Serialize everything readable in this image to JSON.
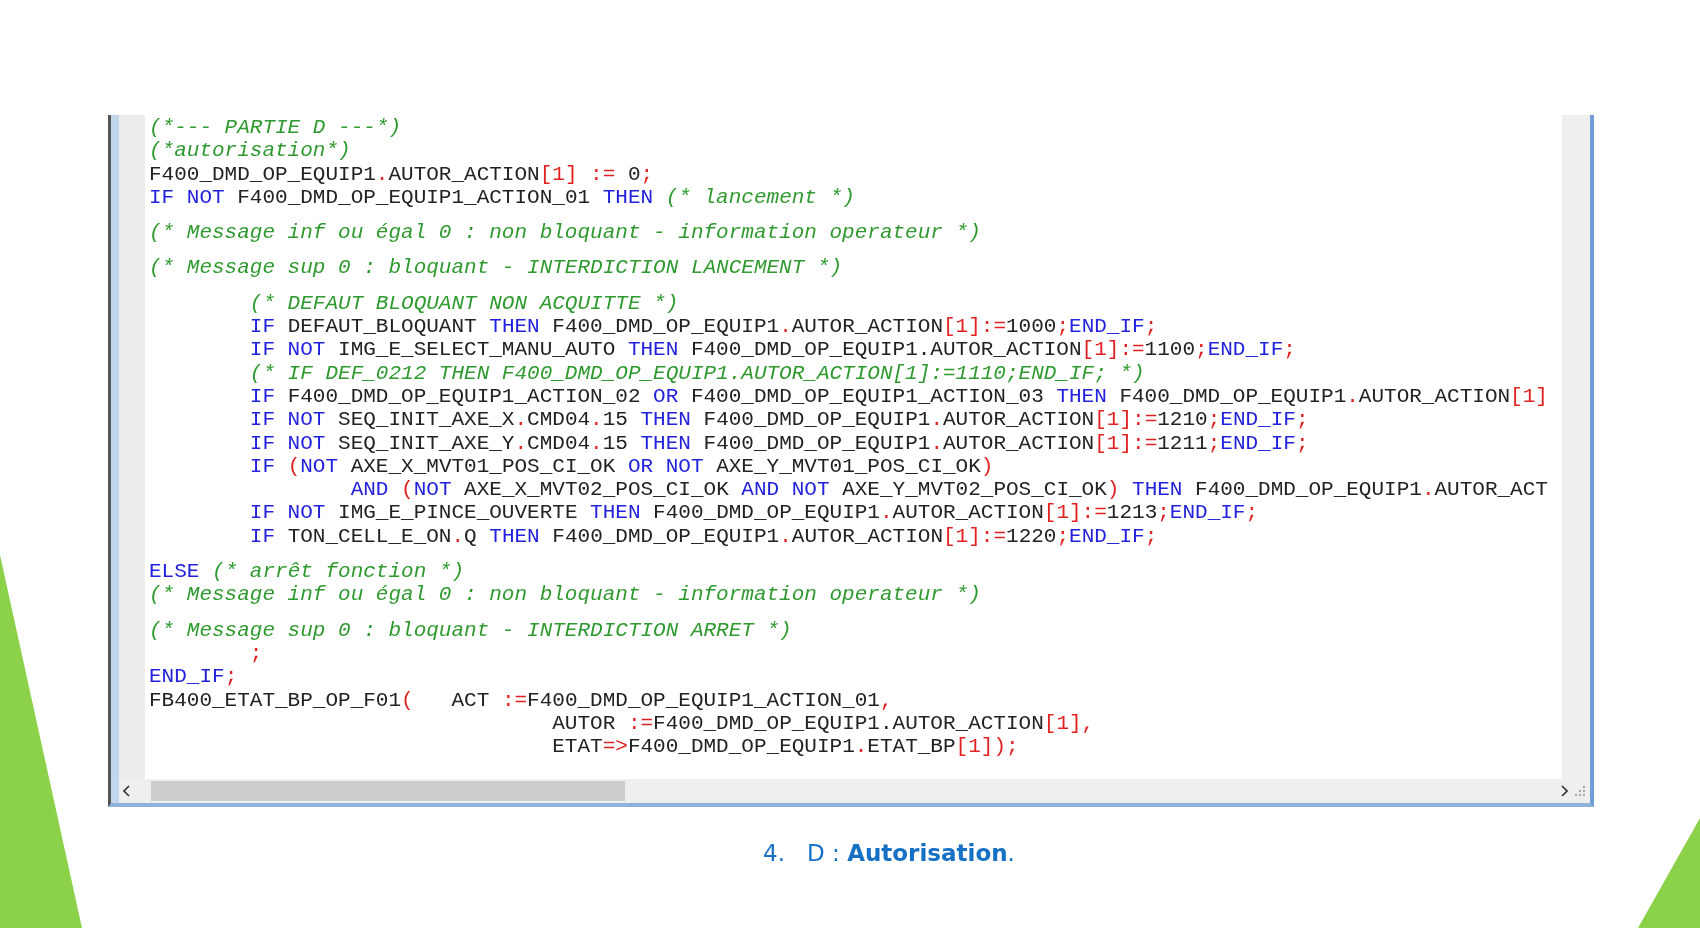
{
  "editor": {
    "blocks": [
      {
        "lines": [
          {
            "tokens": [
              {
                "kind": "cmt",
                "text": "(*--- PARTIE D ---*)"
              }
            ]
          },
          {
            "tokens": [
              {
                "kind": "cmt",
                "text": "(*autorisation*)"
              }
            ]
          },
          {
            "tokens": [
              {
                "kind": "id",
                "text": "F400_DMD_OP_EQUIP1"
              },
              {
                "kind": "op",
                "text": "."
              },
              {
                "kind": "id",
                "text": "AUTOR_ACTION"
              },
              {
                "kind": "op",
                "text": "[1]"
              },
              {
                "kind": "op",
                "text": " :="
              },
              {
                "kind": "id",
                "text": " 0"
              },
              {
                "kind": "op",
                "text": ";"
              }
            ]
          },
          {
            "tokens": [
              {
                "kind": "kw",
                "text": "IF NOT"
              },
              {
                "kind": "id",
                "text": " F400_DMD_OP_EQUIP1_ACTION_01 "
              },
              {
                "kind": "kw",
                "text": "THEN"
              },
              {
                "kind": "cmt",
                "text": " (* lancement *)"
              }
            ]
          }
        ]
      },
      {
        "lines": [
          {
            "tokens": [
              {
                "kind": "cmt",
                "text": "(* Message inf ou égal 0 : non bloquant - information operateur *)"
              }
            ]
          }
        ]
      },
      {
        "lines": [
          {
            "tokens": [
              {
                "kind": "cmt",
                "text": "(* Message sup 0 : bloquant - INTERDICTION LANCEMENT *)"
              }
            ]
          }
        ]
      },
      {
        "lines": [
          {
            "tokens": [
              {
                "kind": "cmt",
                "text": "        (* DEFAUT BLOQUANT NON ACQUITTE *)"
              }
            ]
          },
          {
            "tokens": [
              {
                "kind": "kw",
                "text": "        IF"
              },
              {
                "kind": "id",
                "text": " DEFAUT_BLOQUANT "
              },
              {
                "kind": "kw",
                "text": "THEN"
              },
              {
                "kind": "id",
                "text": " F400_DMD_OP_EQUIP1"
              },
              {
                "kind": "op",
                "text": "."
              },
              {
                "kind": "id",
                "text": "AUTOR_ACTION"
              },
              {
                "kind": "op",
                "text": "[1]:="
              },
              {
                "kind": "id",
                "text": "1000"
              },
              {
                "kind": "op",
                "text": ";"
              },
              {
                "kind": "kw",
                "text": "END_IF"
              },
              {
                "kind": "op",
                "text": ";"
              }
            ]
          },
          {
            "tokens": [
              {
                "kind": "kw",
                "text": "        IF NOT"
              },
              {
                "kind": "id",
                "text": " IMG_E_SELECT_MANU_AUTO "
              },
              {
                "kind": "kw",
                "text": "THEN"
              },
              {
                "kind": "id",
                "text": " F400_DMD_OP_EQUIP1.AUTOR_ACTION"
              },
              {
                "kind": "op",
                "text": "[1]:="
              },
              {
                "kind": "id",
                "text": "1100"
              },
              {
                "kind": "op",
                "text": ";"
              },
              {
                "kind": "kw",
                "text": "END_IF"
              },
              {
                "kind": "op",
                "text": ";"
              }
            ]
          },
          {
            "tokens": [
              {
                "kind": "cmt",
                "text": "        (* IF DEF_0212 THEN F400_DMD_OP_EQUIP1.AUTOR_ACTION[1]:=1110;END_IF; *)"
              }
            ]
          },
          {
            "tokens": [
              {
                "kind": "kw",
                "text": "        IF"
              },
              {
                "kind": "id",
                "text": " F400_DMD_OP_EQUIP1_ACTION_02 "
              },
              {
                "kind": "kw",
                "text": "OR"
              },
              {
                "kind": "id",
                "text": " F400_DMD_OP_EQUIP1_ACTION_03 "
              },
              {
                "kind": "kw",
                "text": "THEN"
              },
              {
                "kind": "id",
                "text": " F400_DMD_OP_EQUIP1"
              },
              {
                "kind": "op",
                "text": "."
              },
              {
                "kind": "id",
                "text": "AUTOR_ACTION"
              },
              {
                "kind": "op",
                "text": "[1]"
              }
            ]
          },
          {
            "tokens": [
              {
                "kind": "kw",
                "text": "        IF NOT"
              },
              {
                "kind": "id",
                "text": " SEQ_INIT_AXE_X"
              },
              {
                "kind": "op",
                "text": "."
              },
              {
                "kind": "id",
                "text": "CMD04"
              },
              {
                "kind": "op",
                "text": "."
              },
              {
                "kind": "id",
                "text": "15 "
              },
              {
                "kind": "kw",
                "text": "THEN"
              },
              {
                "kind": "id",
                "text": " F400_DMD_OP_EQUIP1"
              },
              {
                "kind": "op",
                "text": "."
              },
              {
                "kind": "id",
                "text": "AUTOR_ACTION"
              },
              {
                "kind": "op",
                "text": "[1]:="
              },
              {
                "kind": "id",
                "text": "1210"
              },
              {
                "kind": "op",
                "text": ";"
              },
              {
                "kind": "kw",
                "text": "END_IF"
              },
              {
                "kind": "op",
                "text": ";"
              }
            ]
          },
          {
            "tokens": [
              {
                "kind": "kw",
                "text": "        IF NOT"
              },
              {
                "kind": "id",
                "text": " SEQ_INIT_AXE_Y"
              },
              {
                "kind": "op",
                "text": "."
              },
              {
                "kind": "id",
                "text": "CMD04"
              },
              {
                "kind": "op",
                "text": "."
              },
              {
                "kind": "id",
                "text": "15 "
              },
              {
                "kind": "kw",
                "text": "THEN"
              },
              {
                "kind": "id",
                "text": " F400_DMD_OP_EQUIP1"
              },
              {
                "kind": "op",
                "text": "."
              },
              {
                "kind": "id",
                "text": "AUTOR_ACTION"
              },
              {
                "kind": "op",
                "text": "[1]:="
              },
              {
                "kind": "id",
                "text": "1211"
              },
              {
                "kind": "op",
                "text": ";"
              },
              {
                "kind": "kw",
                "text": "END_IF"
              },
              {
                "kind": "op",
                "text": ";"
              }
            ]
          },
          {
            "tokens": [
              {
                "kind": "kw",
                "text": "        IF"
              },
              {
                "kind": "op",
                "text": " ("
              },
              {
                "kind": "kw",
                "text": "NOT"
              },
              {
                "kind": "id",
                "text": " AXE_X_MVT01_POS_CI_OK "
              },
              {
                "kind": "kw",
                "text": "OR NOT"
              },
              {
                "kind": "id",
                "text": " AXE_Y_MVT01_POS_CI_OK"
              },
              {
                "kind": "op",
                "text": ")"
              }
            ]
          },
          {
            "tokens": [
              {
                "kind": "kw",
                "text": "                AND"
              },
              {
                "kind": "op",
                "text": " ("
              },
              {
                "kind": "kw",
                "text": "NOT"
              },
              {
                "kind": "id",
                "text": " AXE_X_MVT02_POS_CI_OK "
              },
              {
                "kind": "kw",
                "text": "AND NOT"
              },
              {
                "kind": "id",
                "text": " AXE_Y_MVT02_POS_CI_OK"
              },
              {
                "kind": "op",
                "text": ")"
              },
              {
                "kind": "kw",
                "text": " THEN"
              },
              {
                "kind": "id",
                "text": " F400_DMD_OP_EQUIP1"
              },
              {
                "kind": "op",
                "text": "."
              },
              {
                "kind": "id",
                "text": "AUTOR_ACT"
              }
            ]
          },
          {
            "tokens": [
              {
                "kind": "kw",
                "text": "        IF NOT"
              },
              {
                "kind": "id",
                "text": " IMG_E_PINCE_OUVERTE "
              },
              {
                "kind": "kw",
                "text": "THEN"
              },
              {
                "kind": "id",
                "text": " F400_DMD_OP_EQUIP1"
              },
              {
                "kind": "op",
                "text": "."
              },
              {
                "kind": "id",
                "text": "AUTOR_ACTION"
              },
              {
                "kind": "op",
                "text": "[1]:="
              },
              {
                "kind": "id",
                "text": "1213"
              },
              {
                "kind": "op",
                "text": ";"
              },
              {
                "kind": "kw",
                "text": "END_IF"
              },
              {
                "kind": "op",
                "text": ";"
              }
            ]
          },
          {
            "tokens": [
              {
                "kind": "kw",
                "text": "        IF"
              },
              {
                "kind": "id",
                "text": " TON_CELL_E_ON"
              },
              {
                "kind": "op",
                "text": "."
              },
              {
                "kind": "id",
                "text": "Q "
              },
              {
                "kind": "kw",
                "text": "THEN"
              },
              {
                "kind": "id",
                "text": " F400_DMD_OP_EQUIP1"
              },
              {
                "kind": "op",
                "text": "."
              },
              {
                "kind": "id",
                "text": "AUTOR_ACTION"
              },
              {
                "kind": "op",
                "text": "[1]:="
              },
              {
                "kind": "id",
                "text": "1220"
              },
              {
                "kind": "op",
                "text": ";"
              },
              {
                "kind": "kw",
                "text": "END_IF"
              },
              {
                "kind": "op",
                "text": ";"
              }
            ]
          }
        ]
      },
      {
        "lines": [
          {
            "tokens": [
              {
                "kind": "kw",
                "text": "ELSE"
              },
              {
                "kind": "cmt",
                "text": " (* arrêt fonction *)"
              }
            ]
          },
          {
            "tokens": [
              {
                "kind": "cmt",
                "text": "(* Message inf ou égal 0 : non bloquant - information operateur *)"
              }
            ]
          }
        ]
      },
      {
        "lines": [
          {
            "tokens": [
              {
                "kind": "cmt",
                "text": "(* Message sup 0 : bloquant - INTERDICTION ARRET *)"
              }
            ]
          },
          {
            "tokens": [
              {
                "kind": "op",
                "text": "        ;"
              }
            ]
          },
          {
            "tokens": [
              {
                "kind": "kw",
                "text": "END_IF"
              },
              {
                "kind": "op",
                "text": ";"
              }
            ]
          },
          {
            "tokens": [
              {
                "kind": "id",
                "text": "FB400_ETAT_BP_OP_F01"
              },
              {
                "kind": "op",
                "text": "("
              },
              {
                "kind": "id",
                "text": "   ACT "
              },
              {
                "kind": "op",
                "text": ":="
              },
              {
                "kind": "id",
                "text": "F400_DMD_OP_EQUIP1_ACTION_01"
              },
              {
                "kind": "op",
                "text": ","
              }
            ]
          },
          {
            "tokens": [
              {
                "kind": "id",
                "text": "                                AUTOR "
              },
              {
                "kind": "op",
                "text": ":="
              },
              {
                "kind": "id",
                "text": "F400_DMD_OP_EQUIP1.AUTOR_ACTION"
              },
              {
                "kind": "op",
                "text": "[1],"
              }
            ]
          },
          {
            "tokens": [
              {
                "kind": "id",
                "text": "                                ETAT"
              },
              {
                "kind": "op",
                "text": "=>"
              },
              {
                "kind": "id",
                "text": "F400_DMD_OP_EQUIP1"
              },
              {
                "kind": "op",
                "text": "."
              },
              {
                "kind": "id",
                "text": "ETAT_BP"
              },
              {
                "kind": "op",
                "text": "[1]);"
              }
            ]
          }
        ]
      }
    ]
  },
  "caption": {
    "number": "4.",
    "text": "D : **Autorisation**."
  }
}
